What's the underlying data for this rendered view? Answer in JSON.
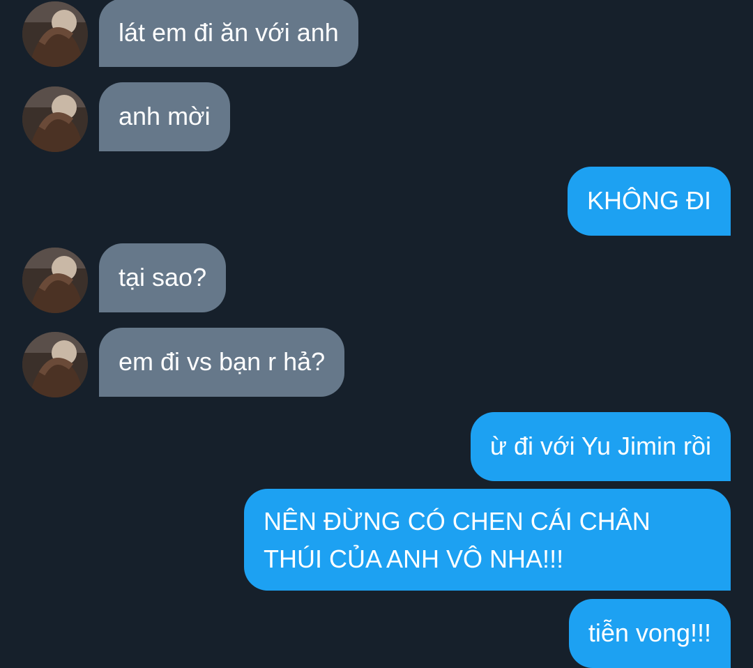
{
  "conversation": {
    "messages": [
      {
        "text": "lát em đi ăn với anh"
      },
      {
        "text": "anh mời"
      },
      {
        "text": "KHÔNG ĐI"
      },
      {
        "text": "tại sao?"
      },
      {
        "text": "em đi vs bạn r hả?"
      },
      {
        "text": "ừ đi với Yu Jimin rồi"
      },
      {
        "text": "NÊN ĐỪNG CÓ CHEN CÁI CHÂN",
        "text2": "THÚI CỦA ANH VÔ NHA!!!"
      },
      {
        "text": "tiễn vong!!!"
      }
    ]
  },
  "colors": {
    "background": "#16202b",
    "incoming_bubble": "#66788a",
    "outgoing_bubble": "#1da1f2",
    "text": "#ffffff"
  },
  "icons": {
    "avatar": "user-avatar-photo"
  }
}
